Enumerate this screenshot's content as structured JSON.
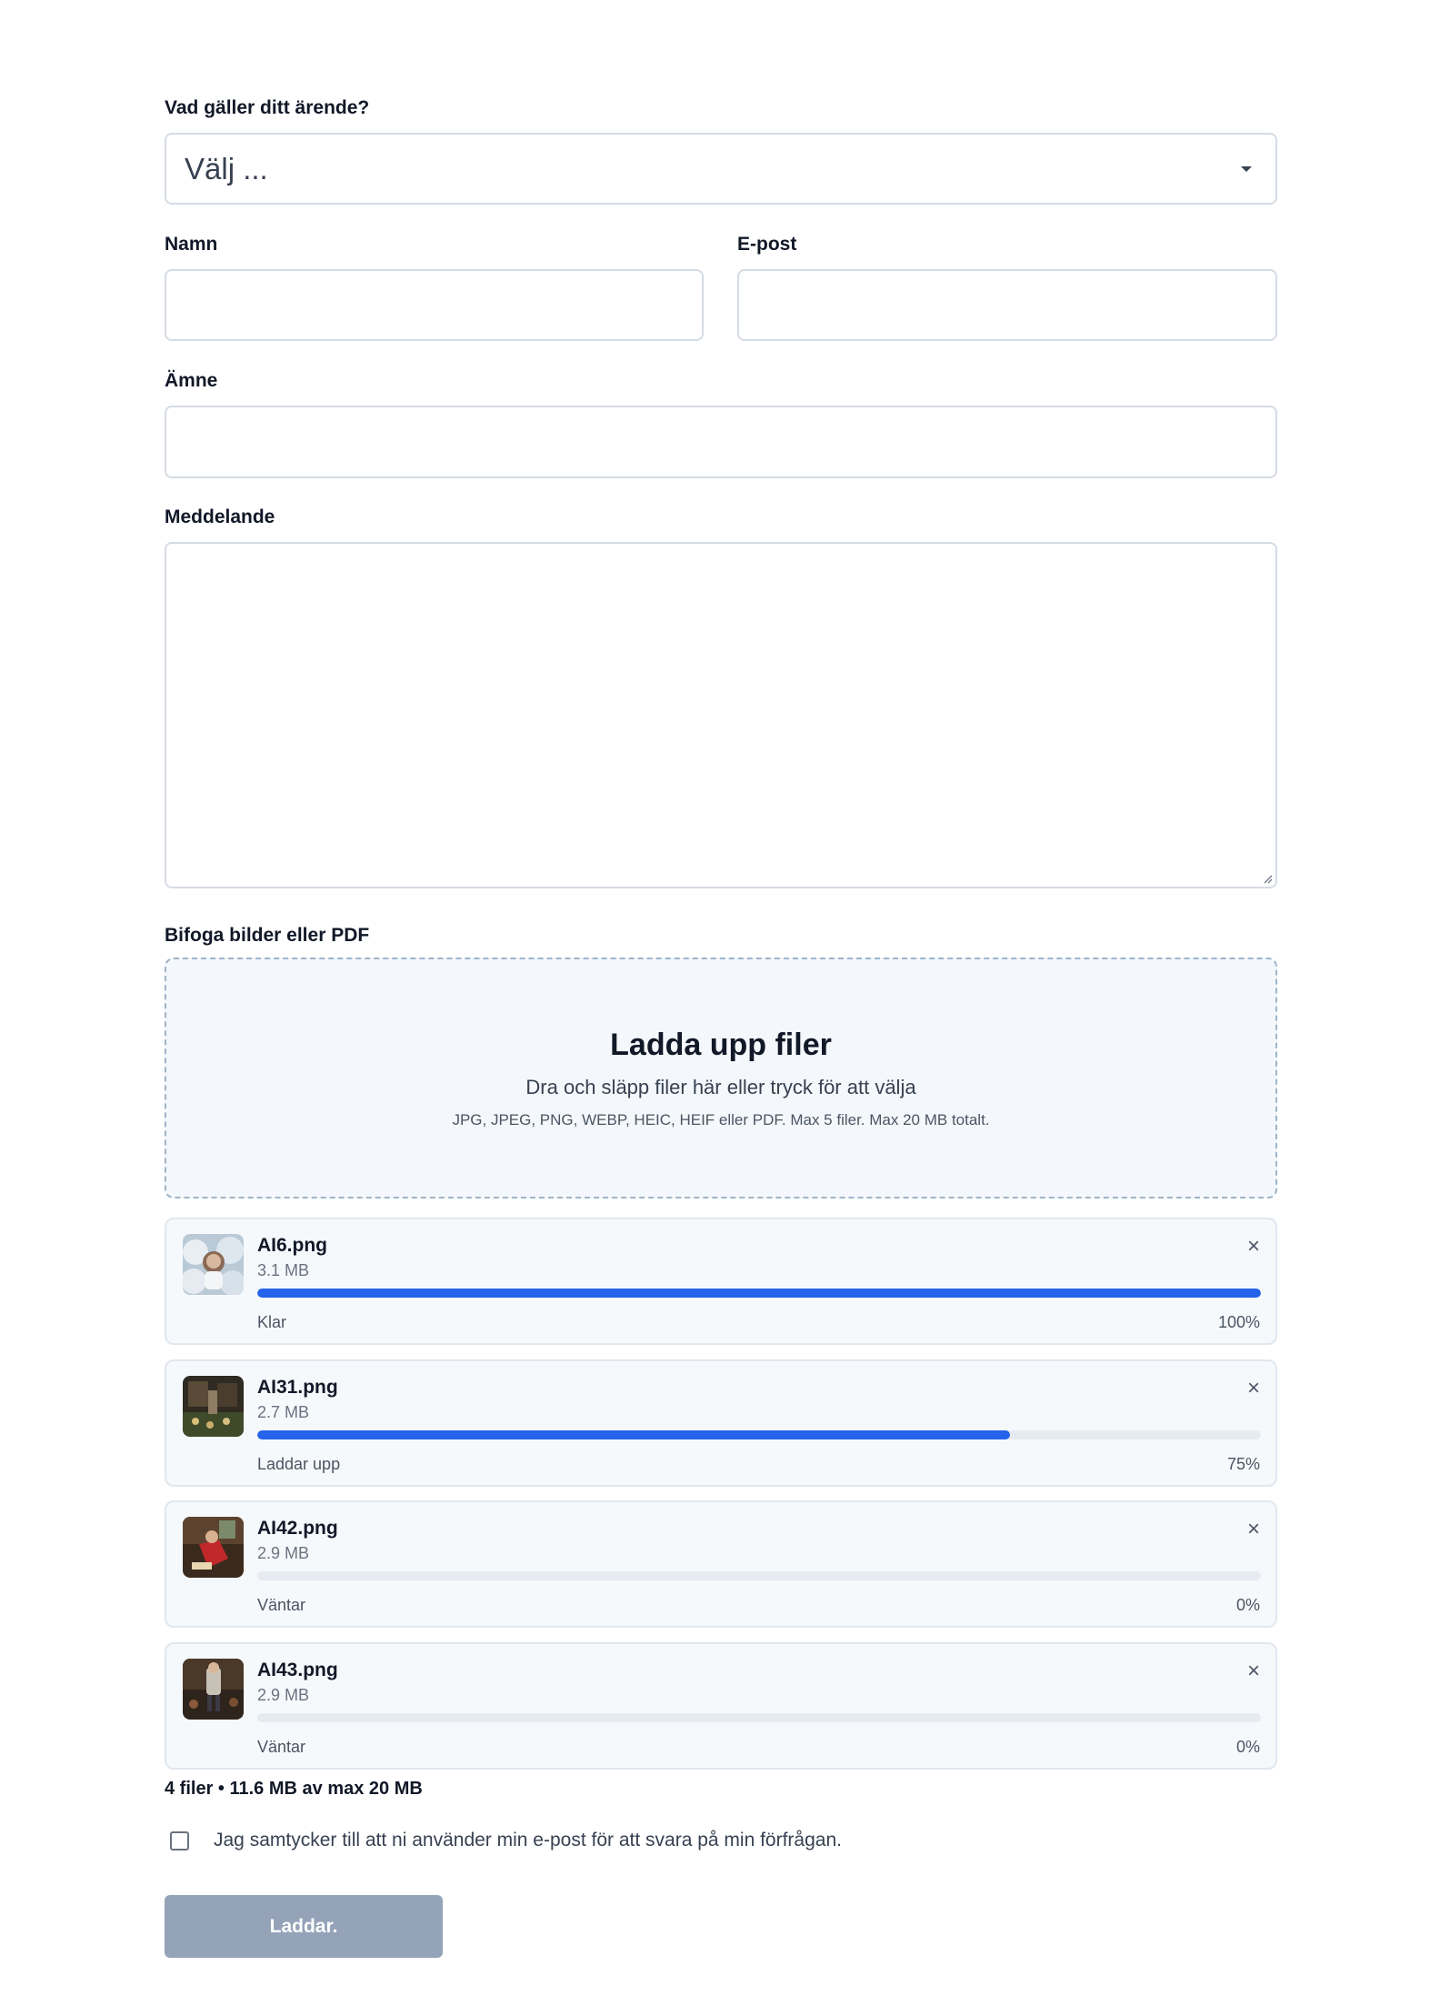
{
  "topic": {
    "label": "Vad gäller ditt ärende?",
    "selected": "Välj ..."
  },
  "name": {
    "label": "Namn",
    "value": ""
  },
  "email": {
    "label": "E-post",
    "value": ""
  },
  "subject": {
    "label": "Ämne",
    "value": ""
  },
  "message": {
    "label": "Meddelande",
    "value": ""
  },
  "attachments": {
    "label": "Bifoga bilder eller PDF",
    "dropzone": {
      "title": "Ladda upp filer",
      "subtitle": "Dra och släpp filer här eller tryck för att välja",
      "note": "JPG, JPEG, PNG, WEBP, HEIC, HEIF eller PDF. Max 5 filer. Max 20 MB totalt."
    },
    "files": [
      {
        "name": "AI6.png",
        "size": "3.1 MB",
        "status": "Klar",
        "percent_label": "100%",
        "progress": 1.0
      },
      {
        "name": "AI31.png",
        "size": "2.7 MB",
        "status": "Laddar upp",
        "percent_label": "75%",
        "progress": 0.75
      },
      {
        "name": "AI42.png",
        "size": "2.9 MB",
        "status": "Väntar",
        "percent_label": "0%",
        "progress": 0
      },
      {
        "name": "AI43.png",
        "size": "2.9 MB",
        "status": "Väntar",
        "percent_label": "0%",
        "progress": 0
      }
    ],
    "remove_glyph": "×",
    "summary": "4 filer • 11.6 MB av max 20 MB"
  },
  "consent": {
    "text": "Jag samtycker till att ni använder min e-post för att svara på min förfrågan.",
    "checked": false
  },
  "submit": {
    "label": "Laddar."
  },
  "colors": {
    "progress": "#2563eb",
    "track": "#e6ebf2",
    "submit_disabled": "#94a3b8",
    "dropzone_border": "#9db4c9"
  },
  "icons": {
    "select": "chevron-down-icon",
    "remove": "close-icon",
    "resize": "resize-grip-icon"
  }
}
